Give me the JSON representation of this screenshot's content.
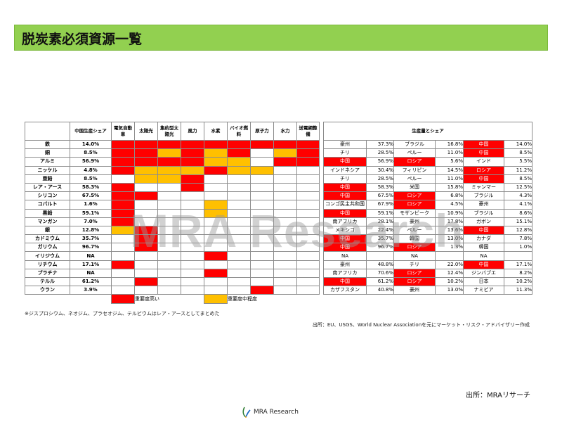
{
  "title": "脱炭素必須資源一覧",
  "header": {
    "share": "中国生産シェア",
    "uses": [
      "電気自動車",
      "太陽光",
      "集約型太陽光",
      "風力",
      "水素",
      "バイオ燃料",
      "原子力",
      "水力",
      "送電網整備"
    ],
    "production": "生産量とシェア"
  },
  "rows": [
    {
      "name": "鉄",
      "share": "14.0%",
      "uses": [
        "hi",
        "hi",
        "hi",
        "hi",
        "hi",
        "hi",
        "hi",
        "hi",
        "hi"
      ],
      "prod": [
        [
          "豪州",
          "37.3%",
          ""
        ],
        [
          "ブラジル",
          "16.8%",
          ""
        ],
        [
          "中国",
          "14.0%",
          "hi"
        ]
      ]
    },
    {
      "name": "銅",
      "share": "8.5%",
      "uses": [
        "hi",
        "hi",
        "mid",
        "hi",
        "mid",
        "hi",
        "",
        "mid",
        "hi"
      ],
      "prod": [
        [
          "チリ",
          "28.5%",
          ""
        ],
        [
          "ペルー",
          "11.0%",
          ""
        ],
        [
          "中国",
          "8.5%",
          "hi"
        ]
      ]
    },
    {
      "name": "アルミ",
      "share": "56.9%",
      "uses": [
        "hi",
        "hi",
        "hi",
        "hi",
        "mid",
        "mid",
        "",
        "hi",
        "hi"
      ],
      "prod": [
        [
          "中国",
          "56.9%",
          "hi"
        ],
        [
          "ロシア",
          "5.6%",
          "hi"
        ],
        [
          "インド",
          "5.5%",
          ""
        ]
      ]
    },
    {
      "name": "ニッケル",
      "share": "4.8%",
      "uses": [
        "hi",
        "mid",
        "mid",
        "mid",
        "hi",
        "mid",
        "mid",
        "",
        ""
      ],
      "prod": [
        [
          "インドネシア",
          "30.4%",
          ""
        ],
        [
          "フィリピン",
          "14.5%",
          ""
        ],
        [
          "ロシア",
          "11.2%",
          "hi"
        ]
      ]
    },
    {
      "name": "亜鉛",
      "share": "8.5%",
      "uses": [
        "",
        "mid",
        "mid",
        "hi",
        "",
        "",
        "",
        "",
        ""
      ],
      "prod": [
        [
          "チリ",
          "28.5%",
          ""
        ],
        [
          "ペルー",
          "11.0%",
          ""
        ],
        [
          "中国",
          "8.5%",
          "hi"
        ]
      ]
    },
    {
      "name": "レア・アース",
      "share": "58.3%",
      "uses": [
        "hi",
        "",
        "",
        "hi",
        "",
        "",
        "",
        "",
        ""
      ],
      "prod": [
        [
          "中国",
          "58.3%",
          "hi"
        ],
        [
          "米国",
          "15.8%",
          ""
        ],
        [
          "ミャンマー",
          "12.5%",
          ""
        ]
      ]
    },
    {
      "name": "シリコン",
      "share": "67.5%",
      "uses": [
        "hi",
        "hi",
        "",
        "",
        "",
        "",
        "",
        "",
        ""
      ],
      "prod": [
        [
          "中国",
          "67.5%",
          "hi"
        ],
        [
          "ロシア",
          "6.8%",
          "hi"
        ],
        [
          "ブラジル",
          "4.3%",
          ""
        ]
      ]
    },
    {
      "name": "コバルト",
      "share": "1.6%",
      "uses": [
        "hi",
        "",
        "",
        "",
        "mid",
        "",
        "",
        "",
        ""
      ],
      "prod": [
        [
          "コンゴ民主共和国",
          "67.9%",
          ""
        ],
        [
          "ロシア",
          "4.5%",
          "hi"
        ],
        [
          "豪州",
          "4.1%",
          ""
        ]
      ]
    },
    {
      "name": "黒鉛",
      "share": "59.1%",
      "uses": [
        "hi",
        "",
        "",
        "",
        "mid",
        "",
        "",
        "",
        ""
      ],
      "prod": [
        [
          "中国",
          "59.1%",
          "hi"
        ],
        [
          "モザンビーク",
          "10.9%",
          ""
        ],
        [
          "ブラジル",
          "8.6%",
          ""
        ]
      ]
    },
    {
      "name": "マンガン",
      "share": "7.0%",
      "uses": [
        "hi",
        "",
        "",
        "",
        "",
        "",
        "",
        "",
        ""
      ],
      "prod": [
        [
          "南アフリカ",
          "28.1%",
          ""
        ],
        [
          "豪州",
          "17.8%",
          ""
        ],
        [
          "ガボン",
          "15.1%",
          ""
        ]
      ]
    },
    {
      "name": "銀",
      "share": "12.8%",
      "uses": [
        "mid",
        "hi",
        "",
        "",
        "",
        "",
        "",
        "",
        ""
      ],
      "prod": [
        [
          "メキシコ",
          "22.4%",
          ""
        ],
        [
          "ペルー",
          "13.6%",
          ""
        ],
        [
          "中国",
          "12.8%",
          "hi"
        ]
      ]
    },
    {
      "name": "カドミウム",
      "share": "35.7%",
      "uses": [
        "",
        "hi",
        "",
        "",
        "",
        "",
        "",
        "",
        ""
      ],
      "prod": [
        [
          "中国",
          "35.7%",
          "hi"
        ],
        [
          "韓国",
          "13.0%",
          ""
        ],
        [
          "カナダ",
          "7.8%",
          ""
        ]
      ]
    },
    {
      "name": "ガリウム",
      "share": "96.7%",
      "uses": [
        "",
        "hi",
        "",
        "",
        "",
        "",
        "",
        "",
        ""
      ],
      "prod": [
        [
          "中国",
          "96.7%",
          "hi"
        ],
        [
          "ロシア",
          "1.3%",
          "hi"
        ],
        [
          "韓国",
          "1.0%",
          ""
        ]
      ]
    },
    {
      "name": "イリジウム",
      "share": "NA",
      "uses": [
        "",
        "",
        "",
        "",
        "hi",
        "",
        "",
        "",
        ""
      ],
      "prod": [
        [
          "NA",
          "",
          ""
        ],
        [
          "NA",
          "",
          ""
        ],
        [
          "NA",
          "",
          ""
        ]
      ]
    },
    {
      "name": "リチウム",
      "share": "17.1%",
      "uses": [
        "hi",
        "",
        "",
        "",
        "",
        "",
        "",
        "",
        ""
      ],
      "prod": [
        [
          "豪州",
          "48.8%",
          ""
        ],
        [
          "チリ",
          "22.0%",
          ""
        ],
        [
          "中国",
          "17.1%",
          "hi"
        ]
      ]
    },
    {
      "name": "プラチナ",
      "share": "NA",
      "uses": [
        "",
        "",
        "",
        "",
        "hi",
        "",
        "",
        "",
        ""
      ],
      "prod": [
        [
          "南アフリカ",
          "70.6%",
          ""
        ],
        [
          "ロシア",
          "12.4%",
          "hi"
        ],
        [
          "ジンバブエ",
          "8.2%",
          ""
        ]
      ]
    },
    {
      "name": "テルル",
      "share": "61.2%",
      "uses": [
        "",
        "hi",
        "",
        "",
        "",
        "",
        "",
        "",
        ""
      ],
      "prod": [
        [
          "中国",
          "61.2%",
          "hi"
        ],
        [
          "ロシア",
          "10.2%",
          "hi"
        ],
        [
          "日本",
          "10.2%",
          ""
        ]
      ]
    },
    {
      "name": "ウラン",
      "share": "3.9%",
      "uses": [
        "",
        "",
        "",
        "",
        "",
        "",
        "hi",
        "",
        ""
      ],
      "prod": [
        [
          "カザフスタン",
          "40.8%",
          ""
        ],
        [
          "豪州",
          "13.0%",
          ""
        ],
        [
          "ナミビア",
          "11.3%",
          ""
        ]
      ]
    }
  ],
  "legend": {
    "high": "重要度高い",
    "mid": "重要度中程度"
  },
  "colors": {
    "high": "#ff0000",
    "mid": "#ffc000",
    "title_bar": "#92d050"
  },
  "note": "※ジスプロシウム、ネオジム、プラセオジム、テルビウムはレア・アースとしてまとめた",
  "source": "出所：EU、USGS、World Nuclear Associationを元にマーケット・リスク・アドバイザリー作成",
  "source2": "出所：MRAリサーチ",
  "watermark": "MRA Research",
  "logo_text": "MRA Research"
}
